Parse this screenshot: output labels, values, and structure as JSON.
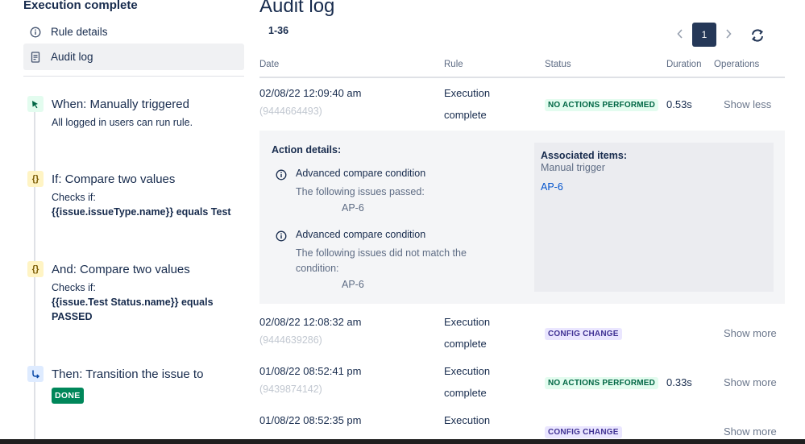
{
  "sidebar": {
    "title": "Execution complete",
    "nav": [
      {
        "label": "Rule details",
        "icon": "info-icon"
      },
      {
        "label": "Audit log",
        "icon": "document-icon"
      }
    ],
    "steps": [
      {
        "type": "trigger",
        "icon": "cursor-click-icon",
        "title": "When: Manually triggered",
        "desc": "All logged in users can run rule."
      },
      {
        "type": "condition",
        "icon": "braces-icon",
        "title": "If: Compare two values",
        "desc_prefix": "Checks if:",
        "desc_bold": "{{issue.issueType.name}} equals Test"
      },
      {
        "type": "condition",
        "icon": "braces-icon",
        "title": "And: Compare two values",
        "desc_prefix": "Checks if:",
        "desc_bold": "{{issue.Test Status.name}} equals PASSED"
      },
      {
        "type": "action",
        "icon": "transition-icon",
        "title": "Then: Transition the issue to",
        "lozenge": "DONE"
      }
    ]
  },
  "main": {
    "title": "Audit log",
    "range": "1-36",
    "pagination": {
      "current_page": "1"
    },
    "columns": {
      "date": "Date",
      "rule": "Rule",
      "status": "Status",
      "duration": "Duration",
      "operations": "Operations"
    },
    "rows": [
      {
        "date": "02/08/22 12:09:40 am",
        "id": "(9444664493)",
        "rule_line1": "Execution",
        "rule_line2": "complete",
        "status": "NO ACTIONS PERFORMED",
        "status_color": "#006644",
        "duration": "0.53s",
        "operation": "Show less"
      },
      {
        "date": "02/08/22 12:08:32 am",
        "id": "(9444639286)",
        "rule_line1": "Execution",
        "rule_line2": "complete",
        "status": "CONFIG CHANGE",
        "status_color": "#403294",
        "duration": "",
        "operation": "Show more"
      },
      {
        "date": "01/08/22 08:52:41 pm",
        "id": "(9439874142)",
        "rule_line1": "Execution",
        "rule_line2": "complete",
        "status": "NO ACTIONS PERFORMED",
        "status_color": "#006644",
        "duration": "0.33s",
        "operation": "Show more"
      },
      {
        "date": "01/08/22 08:52:35 pm",
        "id": "",
        "rule_line1": "Execution",
        "rule_line2": "",
        "status": "CONFIG CHANGE",
        "status_color": "#403294",
        "duration": "",
        "operation": "Show more"
      }
    ],
    "details": {
      "heading": "Action details:",
      "conditions": [
        {
          "title": "Advanced compare condition",
          "desc": "The following issues passed:",
          "key": "AP-6"
        },
        {
          "title": "Advanced compare condition",
          "desc": "The following issues did not match the condition:",
          "key": "AP-6"
        }
      ],
      "associated": {
        "heading": "Associated items:",
        "sub": "Manual trigger",
        "link": "AP-6"
      }
    }
  },
  "colors": {
    "accent": "#253858",
    "link": "#0052cc",
    "done": "#00875a"
  }
}
